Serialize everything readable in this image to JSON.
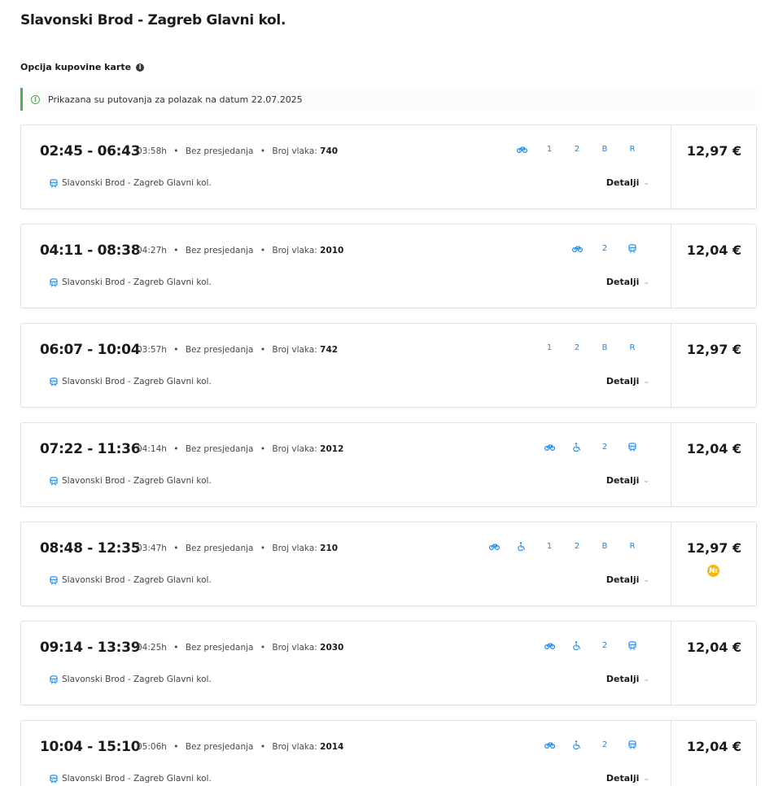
{
  "page": {
    "title": "Slavonski Brod - Zagreb Glavni kol.",
    "section_label": "Opcija kupovine karte",
    "notice": "Prikazana su putovanja za polazak na datum 22.07.2025"
  },
  "labels": {
    "no_transfer": "Bez presjedanja",
    "train_number": "Broj vlaka:",
    "details": "Detalji",
    "separator": "•"
  },
  "trips": [
    {
      "times": "02:45 - 06:43",
      "duration": "03:58h",
      "train_no": "740",
      "route": "Slavonski Brod - Zagreb Glavni kol.",
      "price": "12,97 €",
      "features": [
        "bike-icon",
        "1",
        "2",
        "B",
        "R"
      ],
      "badge": false
    },
    {
      "times": "04:11 - 08:38",
      "duration": "04:27h",
      "train_no": "2010",
      "route": "Slavonski Brod - Zagreb Glavni kol.",
      "price": "12,04 €",
      "features": [
        "bike-icon",
        "2",
        "train-icon"
      ],
      "badge": false
    },
    {
      "times": "06:07 - 10:04",
      "duration": "03:57h",
      "train_no": "742",
      "route": "Slavonski Brod - Zagreb Glavni kol.",
      "price": "12,97 €",
      "features": [
        "1",
        "2",
        "B",
        "R"
      ],
      "badge": false
    },
    {
      "times": "07:22 - 11:36",
      "duration": "04:14h",
      "train_no": "2012",
      "route": "Slavonski Brod - Zagreb Glavni kol.",
      "price": "12,04 €",
      "features": [
        "bike-icon",
        "wheelchair-icon",
        "2",
        "train-icon"
      ],
      "badge": false
    },
    {
      "times": "08:48 - 12:35",
      "duration": "03:47h",
      "train_no": "210",
      "route": "Slavonski Brod - Zagreb Glavni kol.",
      "price": "12,97 €",
      "features": [
        "bike-icon",
        "wheelchair-icon",
        "1",
        "2",
        "B",
        "R"
      ],
      "badge": true
    },
    {
      "times": "09:14 - 13:39",
      "duration": "04:25h",
      "train_no": "2030",
      "route": "Slavonski Brod - Zagreb Glavni kol.",
      "price": "12,04 €",
      "features": [
        "bike-icon",
        "wheelchair-icon",
        "2",
        "train-icon"
      ],
      "badge": false
    },
    {
      "times": "10:04 - 15:10",
      "duration": "05:06h",
      "train_no": "2014",
      "route": "Slavonski Brod - Zagreb Glavni kol.",
      "price": "12,04 €",
      "features": [
        "bike-icon",
        "wheelchair-icon",
        "2",
        "train-icon"
      ],
      "badge": false
    }
  ],
  "colors": {
    "accent": "#1e88e5",
    "notice_border": "#4caf50",
    "badge": "#f3b80f"
  }
}
